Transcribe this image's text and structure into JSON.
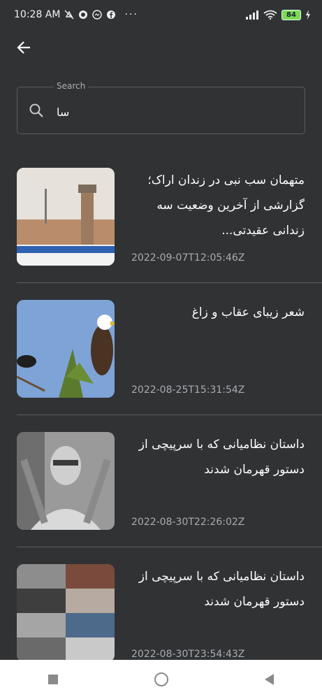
{
  "status_bar": {
    "time": "10:28 AM",
    "dots": "···",
    "battery": "84"
  },
  "search": {
    "legend": "Search",
    "value": "سا"
  },
  "results": [
    {
      "title": "متهمان سب نبی در زندان اراک؛ گزارشی از آخرین وضعیت سه زندانی عقیدتی...",
      "date": "2022-09-07T12:05:46Z"
    },
    {
      "title": "شعر زیبای عقاب و زاغ",
      "date": "2022-08-25T15:31:54Z"
    },
    {
      "title": "داستان نظامیانی که با سرپیچی از دستور قهرمان شدند",
      "date": "2022-08-30T22:26:02Z"
    },
    {
      "title": "داستان نظامیانی که با سرپیچی از دستور قهرمان شدند",
      "date": "2022-08-30T23:54:43Z"
    }
  ]
}
